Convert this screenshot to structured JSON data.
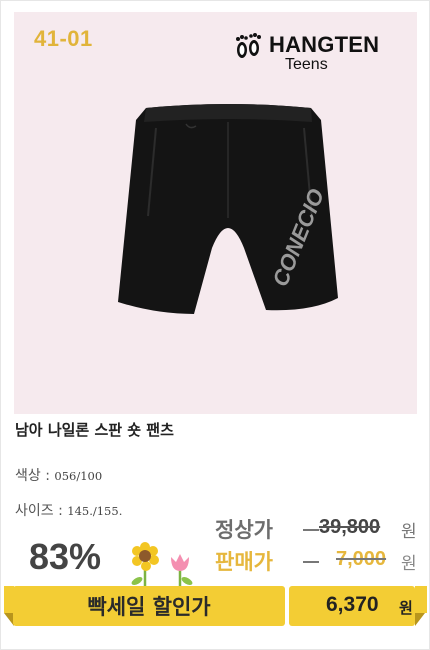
{
  "product": {
    "code": "41-01",
    "brand": {
      "name": "HANGTEN",
      "sub": "Teens"
    },
    "name": "남아 나일론 스판 숏 팬츠",
    "options": {
      "color_label": "색상 : ",
      "color_value": "056/100",
      "size_label": "사이즈 : ",
      "size_value": "145./155."
    },
    "discount": "83%",
    "regular_label": "정상가",
    "regular_price": "39,800",
    "sale_label": "판매가",
    "sale_price": "7,000",
    "currency": "원",
    "banner_label": "빡세일 할인가",
    "final_price": "6,370",
    "final_currency": "원"
  },
  "colors": {
    "accent": "#e6b73d",
    "banner": "#f3cd34",
    "photo_bg": "#f6eaee"
  },
  "icons": [
    "hangten-feet-icon",
    "flower-sunflower-icon",
    "flower-tulip-icon"
  ]
}
